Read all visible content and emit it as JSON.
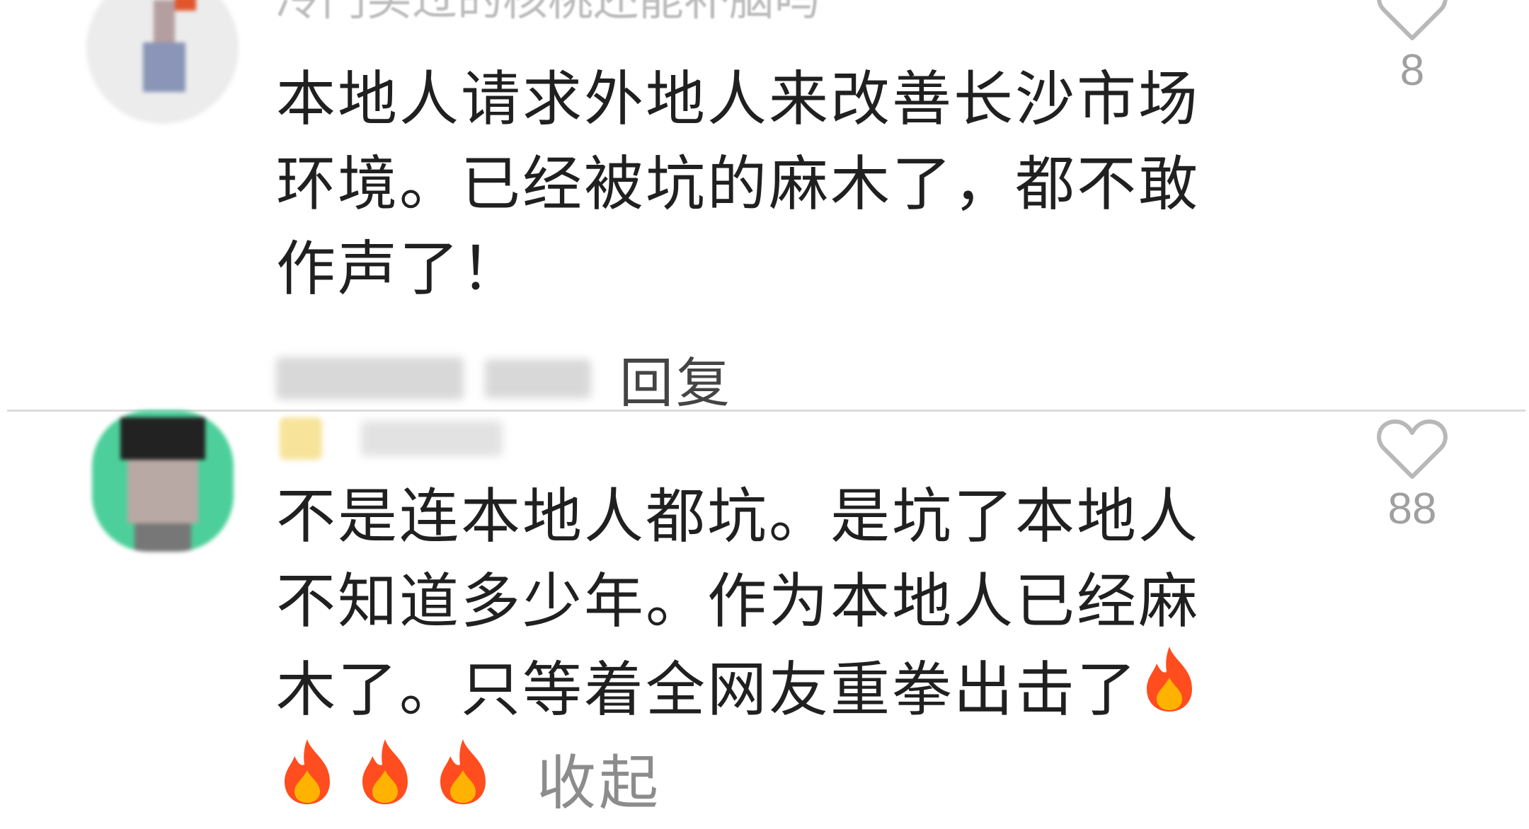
{
  "comments": [
    {
      "header_text": "冷门买过的核桃还能补脑吗",
      "text_lines": [
        "本地人请求外地人来改善长沙市场",
        "环境。已经被坑的麻木了，都不敢",
        "作声了！"
      ],
      "likes": "8",
      "reply_label": "回复"
    },
    {
      "text_lines": [
        "不是连本地人都坑。是坑了本地人",
        "不知道多少年。作为本地人已经麻",
        "木了。只等着全网友重拳出击了"
      ],
      "likes": "88",
      "collapse_label": "收起"
    }
  ],
  "icons": {
    "like": "heart-outline-icon",
    "emoji": "fire-emoji"
  },
  "colors": {
    "text": "#202020",
    "muted": "#a0a0a0",
    "divider": "#dcdcdc",
    "fire_outer": "#ff4d1f",
    "fire_inner": "#ffb300"
  }
}
